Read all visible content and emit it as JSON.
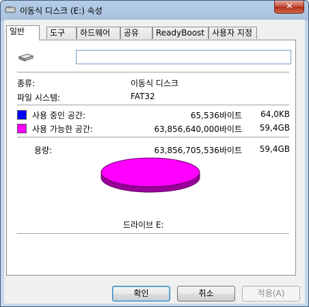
{
  "window": {
    "title": "이동식 디스크 (E:) 속성",
    "close_glyph": "✕"
  },
  "tabs": [
    {
      "label": "일반"
    },
    {
      "label": "도구"
    },
    {
      "label": "하드웨어"
    },
    {
      "label": "공유"
    },
    {
      "label": "ReadyBoost"
    },
    {
      "label": "사용자 지정"
    }
  ],
  "general": {
    "name_value": "",
    "type_label": "종류:",
    "type_value": "이동식 디스크",
    "fs_label": "파일 시스템:",
    "fs_value": "FAT32",
    "used_label": "사용 중인 공간:",
    "used_bytes": "65,536바이트",
    "used_short": "64,0KB",
    "free_label": "사용 가능한 공간:",
    "free_bytes": "63,856,640,000바이트",
    "free_short": "59,4GB",
    "capacity_label": "용량:",
    "capacity_bytes": "63,856,705,536바이트",
    "capacity_short": "59,4GB",
    "drive_label": "드라이브 E:",
    "used_color": "#0000ff",
    "free_color": "#ff00ff",
    "used_fraction": 1e-06
  },
  "buttons": {
    "ok": "확인",
    "cancel": "취소",
    "apply": "적용(A)"
  }
}
